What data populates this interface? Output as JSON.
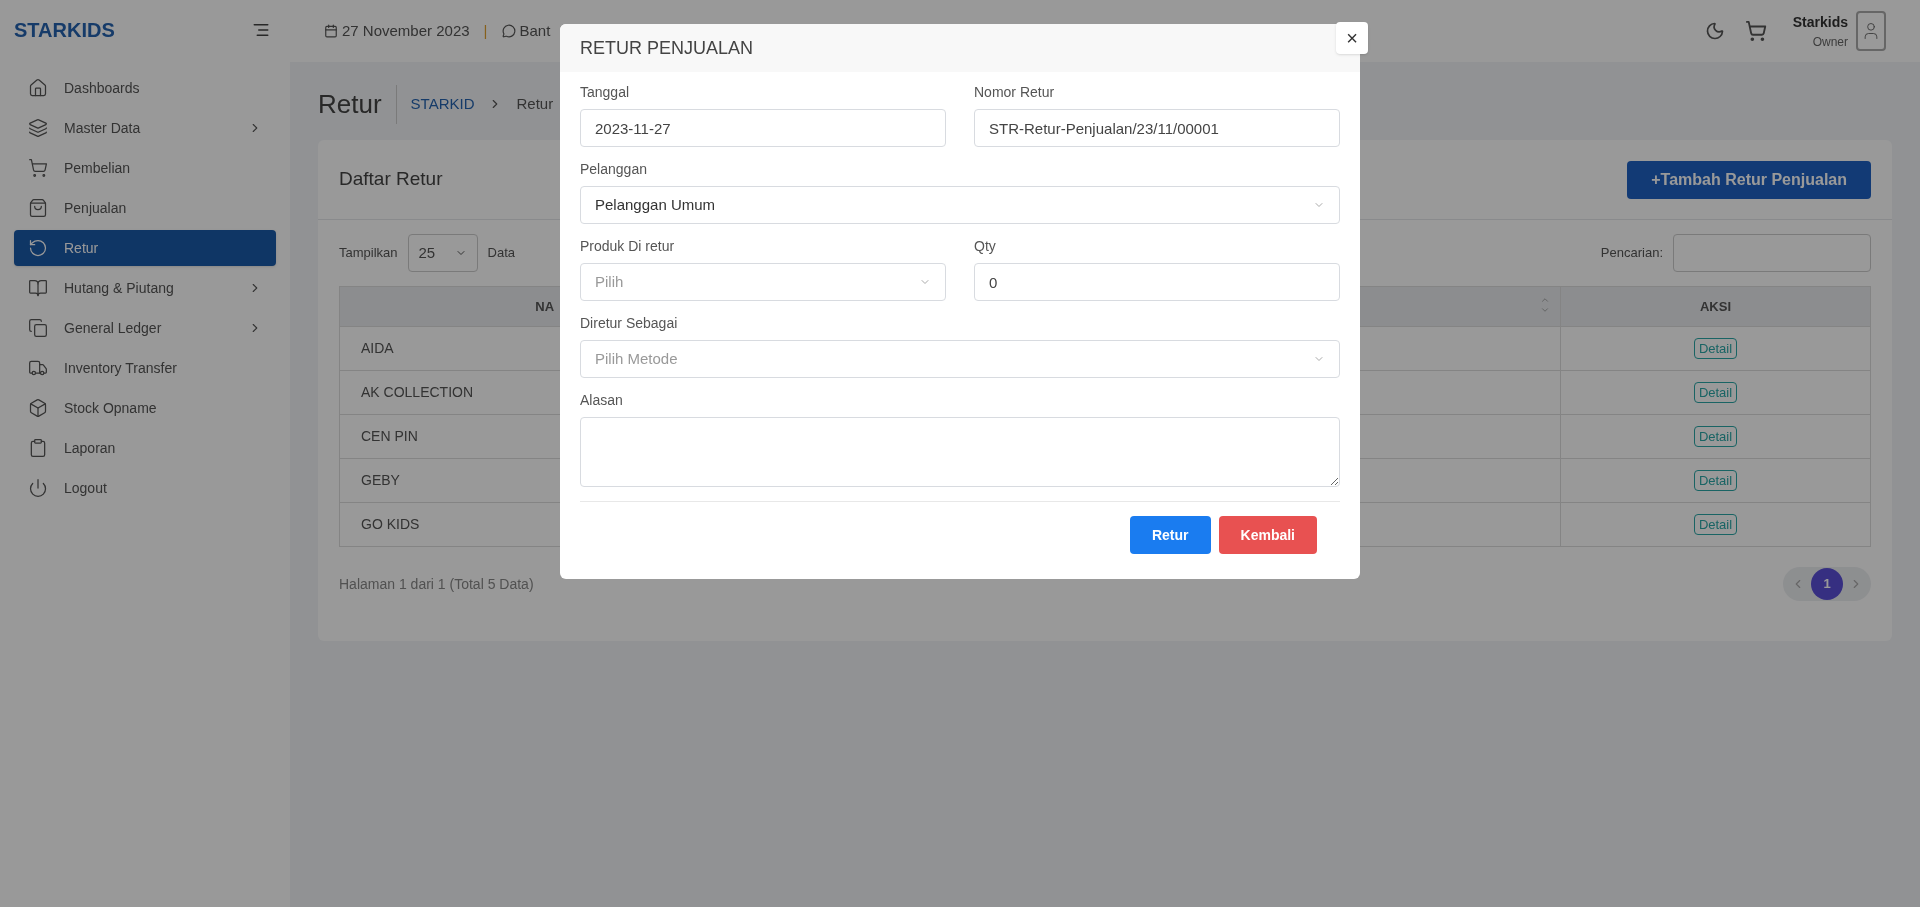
{
  "brand": "STARKIDS",
  "header": {
    "date": "27 November 2023",
    "separator": "|",
    "help": "Bant",
    "user_name": "Starkids",
    "user_role": "Owner"
  },
  "sidebar": {
    "items": [
      {
        "label": "Dashboards",
        "selected": false,
        "submenu": false
      },
      {
        "label": "Master Data",
        "selected": false,
        "submenu": true
      },
      {
        "label": "Pembelian",
        "selected": false,
        "submenu": false
      },
      {
        "label": "Penjualan",
        "selected": false,
        "submenu": false
      },
      {
        "label": "Retur",
        "selected": true,
        "submenu": false
      },
      {
        "label": "Hutang & Piutang",
        "selected": false,
        "submenu": true
      },
      {
        "label": "General Ledger",
        "selected": false,
        "submenu": true
      },
      {
        "label": "Inventory Transfer",
        "selected": false,
        "submenu": false
      },
      {
        "label": "Stock Opname",
        "selected": false,
        "submenu": false
      },
      {
        "label": "Laporan",
        "selected": false,
        "submenu": false
      },
      {
        "label": "Logout",
        "selected": false,
        "submenu": false
      }
    ]
  },
  "page": {
    "title": "Retur",
    "breadcrumb": [
      "STARKID",
      "Retur"
    ]
  },
  "card": {
    "title": "Daftar Retur",
    "add_button": "+Tambah Retur Penjualan",
    "show_label": "Tampilkan",
    "page_size": "25",
    "show_suffix": "Data",
    "search_label": "Pencarian:"
  },
  "table": {
    "columns": [
      "NA",
      "",
      "AKSI"
    ],
    "rows": [
      {
        "name": "AIDA",
        "action": "Detail"
      },
      {
        "name": "AK COLLECTION",
        "action": "Detail"
      },
      {
        "name": "CEN PIN",
        "action": "Detail"
      },
      {
        "name": "GEBY",
        "action": "Detail"
      },
      {
        "name": "GO KIDS",
        "action": "Detail"
      }
    ]
  },
  "footer": {
    "info": "Halaman 1 dari 1 (Total 5 Data)",
    "pages": [
      {
        "label": "1",
        "selected": true
      }
    ]
  },
  "modal": {
    "title": "RETUR PENJUALAN",
    "close": "×",
    "rows": [
      [
        {
          "kind": "input",
          "label": "Tanggal",
          "value": "2023-11-27"
        },
        {
          "kind": "input",
          "label": "Nomor Retur",
          "value": "STR-Retur-Penjualan/23/11/00001"
        }
      ],
      [
        {
          "kind": "select",
          "label": "Pelanggan",
          "value": "Pelanggan Umum"
        }
      ],
      [
        {
          "kind": "select",
          "label": "Produk Di retur",
          "placeholder": "Pilih"
        },
        {
          "kind": "input",
          "label": "Qty",
          "value": "0"
        }
      ],
      [
        {
          "kind": "select",
          "label": "Diretur Sebagai",
          "placeholder": "Pilih Metode"
        }
      ],
      [
        {
          "kind": "textarea",
          "label": "Alasan"
        }
      ]
    ],
    "buttons": [
      {
        "label": "Retur",
        "kind": "primary"
      },
      {
        "label": "Kembali",
        "kind": "danger"
      }
    ]
  }
}
